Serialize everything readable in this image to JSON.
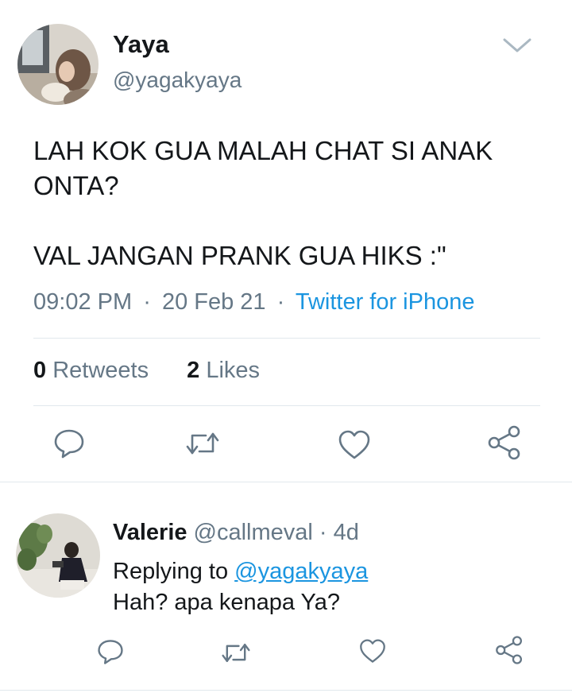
{
  "tweet": {
    "author_name": "Yaya",
    "author_handle": "@yagakyaya",
    "text_line1": "LAH KOK GUA MALAH CHAT SI ANAK",
    "text_line2": "ONTA?",
    "text_line3": "VAL JANGAN PRANK GUA HIKS :\"",
    "time": "09:02 PM",
    "date": "20 Feb 21",
    "separator": "·",
    "source": "Twitter for iPhone",
    "retweets_count": "0",
    "retweets_label": "Retweets",
    "likes_count": "2",
    "likes_label": "Likes"
  },
  "reply": {
    "author_name": "Valerie",
    "author_handle": "@callmeval",
    "separator": "·",
    "age": "4d",
    "replying_to_label": "Replying to",
    "replying_to_handle": "@yagakyaya",
    "text": "Hah? apa kenapa Ya?"
  },
  "icons": {
    "reply": "reply-icon",
    "retweet": "retweet-icon",
    "like": "heart-icon",
    "share": "share-icon",
    "menu": "chevron-down-icon"
  },
  "colors": {
    "text": "#14171a",
    "secondary": "#657786",
    "link": "#1b95e0",
    "divider": "#e1e8ed"
  }
}
